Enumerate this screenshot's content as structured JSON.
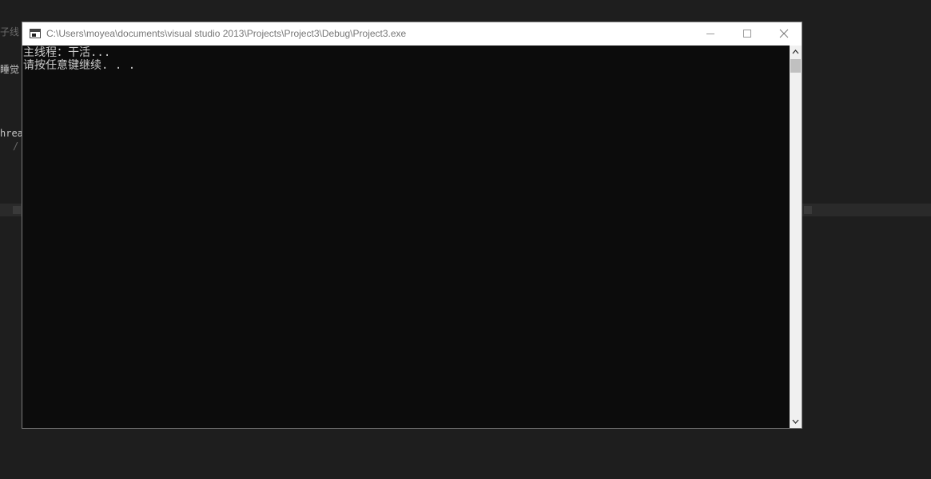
{
  "background_editor": {
    "line1": "子线",
    "line2": "睡觉",
    "line3": "hrea",
    "line4": "/"
  },
  "window": {
    "title": "C:\\Users\\moyea\\documents\\visual studio 2013\\Projects\\Project3\\Debug\\Project3.exe",
    "icon": "console-app-icon",
    "buttons": {
      "minimize": "minimize-icon",
      "maximize": "maximize-icon",
      "close": "close-icon"
    }
  },
  "console": {
    "lines": [
      "主线程：干活...",
      "请按任意键继续. . ."
    ],
    "text_color": "#cccccc",
    "background": "#0c0c0c"
  },
  "scrollbar": {
    "up_icon": "chevron-up-icon",
    "down_icon": "chevron-down-icon"
  }
}
